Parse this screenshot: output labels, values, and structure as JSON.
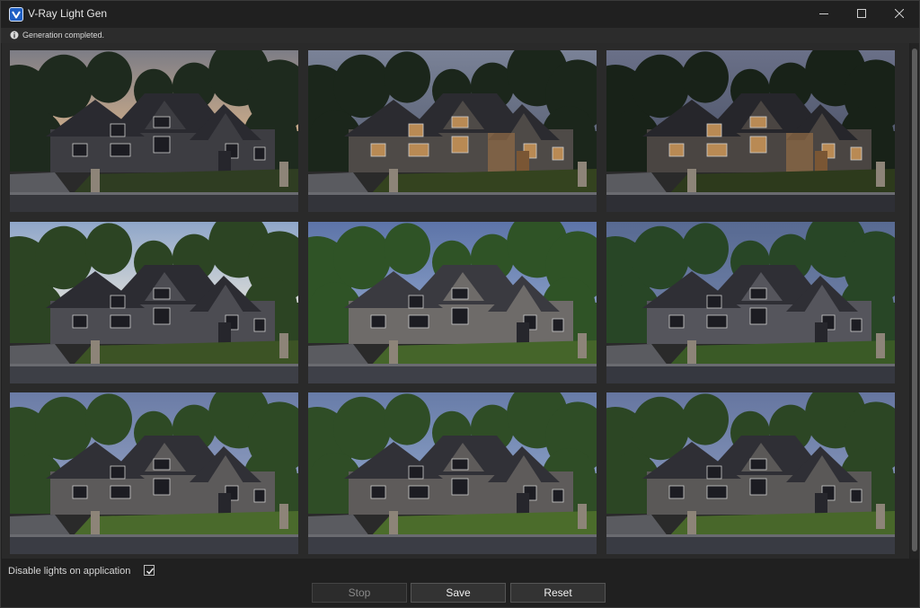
{
  "window": {
    "title": "V-Ray Light Gen",
    "icon": "vray-logo-icon",
    "controls": [
      "minimize-icon",
      "maximize-icon",
      "close-icon"
    ]
  },
  "status": {
    "icon": "info-icon",
    "message": "Generation completed."
  },
  "results": [
    {
      "variant": "dusk-warm-sky",
      "sky": "#d9b38a",
      "sky_top": "#7d7d86",
      "trees": "#1e2a1e",
      "house": "#3d3d42",
      "roof": "#2a2a30",
      "lawn": "#2f3d22",
      "road": "#35363b",
      "warm": false
    },
    {
      "variant": "dusk-warm-lights",
      "sky": "#5b6377",
      "sky_top": "#7a8297",
      "trees": "#1b261b",
      "house": "#4e4a47",
      "roof": "#2b2b30",
      "lawn": "#34431f",
      "road": "#33343a",
      "warm": true
    },
    {
      "variant": "night-warm-lights",
      "sky": "#4f566b",
      "sky_top": "#6a7088",
      "trees": "#182218",
      "house": "#4a4542",
      "roof": "#26262b",
      "lawn": "#2d3a1c",
      "road": "#2e2f35",
      "warm": true
    },
    {
      "variant": "morning-bright-sky",
      "sky": "#e6e4da",
      "sky_top": "#8fa6c9",
      "trees": "#2c4423",
      "house": "#4c4c52",
      "roof": "#2c2c32",
      "lawn": "#3c5325",
      "road": "#3d3f46",
      "warm": false
    },
    {
      "variant": "day-clear",
      "sky": "#8aa0c8",
      "sky_top": "#5d74a8",
      "trees": "#2f5326",
      "house": "#6e6b69",
      "roof": "#3a3a40",
      "lawn": "#45652a",
      "road": "#3e4048",
      "warm": false
    },
    {
      "variant": "overcast",
      "sky": "#6e80a6",
      "sky_top": "#586a92",
      "trees": "#284626",
      "house": "#55555c",
      "roof": "#2f2f35",
      "lawn": "#3a5a26",
      "road": "#363840",
      "warm": false
    },
    {
      "variant": "afternoon-soft",
      "sky": "#8e9dc0",
      "sky_top": "#6b7ca6",
      "trees": "#2e4a25",
      "house": "#5c5a5a",
      "roof": "#303036",
      "lawn": "#4a6a2c",
      "road": "#3a3c44",
      "warm": false
    },
    {
      "variant": "afternoon-clear",
      "sky": "#8aa0c6",
      "sky_top": "#687ca8",
      "trees": "#2f4d26",
      "house": "#5e5b5a",
      "roof": "#313137",
      "lawn": "#4b6c2b",
      "road": "#3b3d45",
      "warm": false
    },
    {
      "variant": "late-afternoon",
      "sky": "#8394b9",
      "sky_top": "#6676a0",
      "trees": "#2c4624",
      "house": "#5a5857",
      "roof": "#2f2f35",
      "lawn": "#48672a",
      "road": "#393b43",
      "warm": false
    }
  ],
  "options": {
    "disable_lights_label": "Disable lights on application",
    "disable_lights_checked": true
  },
  "buttons": {
    "stop": "Stop",
    "save": "Save",
    "reset": "Reset"
  }
}
